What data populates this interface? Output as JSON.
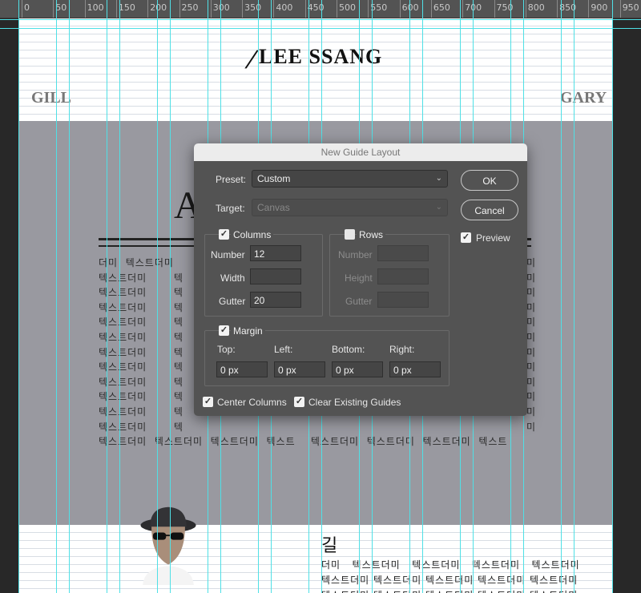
{
  "ruler": {
    "marks": [
      "0",
      "50",
      "100",
      "150",
      "200",
      "250",
      "300",
      "350",
      "400",
      "450",
      "500",
      "550",
      "600",
      "650",
      "700",
      "750",
      "800",
      "850",
      "900",
      "950"
    ]
  },
  "document": {
    "logo": "LEE SSANG",
    "name_left": "GILL",
    "name_right": "GARY",
    "heading_partial": "A",
    "paragraph_lines": [
      "더미  텍스트더미",
      "텍스트더미       텍",
      "텍스트더미       텍",
      "텍스트더미       텍",
      "텍스트더미       텍",
      "텍스트더미       텍",
      "텍스트더미       텍",
      "텍스트더미       텍",
      "텍스트더미       텍",
      "텍스트더미       텍",
      "텍스트더미       텍",
      "텍스트더미       텍",
      "텍스트더미  텍스트더미  텍스트더미  텍스트    텍스트더미  텍스트더미  텍스트더미  텍스트"
    ],
    "paragraph_right_lines": [
      "미",
      "미",
      "미",
      "미",
      "미",
      "미",
      "미",
      "미",
      "미",
      "미",
      "미",
      "미"
    ],
    "section2_title": "길",
    "section2_lines": [
      "더미   텍스트더미   텍스트더미   텍스트더미   텍스트더미",
      "텍스트더미 텍스트더미 텍스트더미 텍스트더미 텍스트더미",
      "텍스트더미 텍스트더미 텍스트더미 텍스트더미 텍스트더미"
    ]
  },
  "dialog": {
    "title": "New Guide Layout",
    "preset_label": "Preset:",
    "preset_value": "Custom",
    "target_label": "Target:",
    "target_value": "Canvas",
    "ok_label": "OK",
    "cancel_label": "Cancel",
    "preview_label": "Preview",
    "preview_checked": true,
    "columns": {
      "label": "Columns",
      "checked": true,
      "number_label": "Number",
      "number_value": "12",
      "width_label": "Width",
      "width_value": "",
      "gutter_label": "Gutter",
      "gutter_value": "20"
    },
    "rows": {
      "label": "Rows",
      "checked": false,
      "number_label": "Number",
      "number_value": "",
      "height_label": "Height",
      "height_value": "",
      "gutter_label": "Gutter",
      "gutter_value": ""
    },
    "margin": {
      "label": "Margin",
      "checked": true,
      "top_label": "Top:",
      "top_value": "0 px",
      "left_label": "Left:",
      "left_value": "0 px",
      "bottom_label": "Bottom:",
      "bottom_value": "0 px",
      "right_label": "Right:",
      "right_value": "0 px"
    },
    "center_columns_label": "Center Columns",
    "center_columns_checked": true,
    "clear_guides_label": "Clear Existing Guides",
    "clear_guides_checked": true
  },
  "colors": {
    "guide": "#4fe0e6",
    "dialog_bg": "#535353",
    "canvas_gray": "#9999a0"
  }
}
